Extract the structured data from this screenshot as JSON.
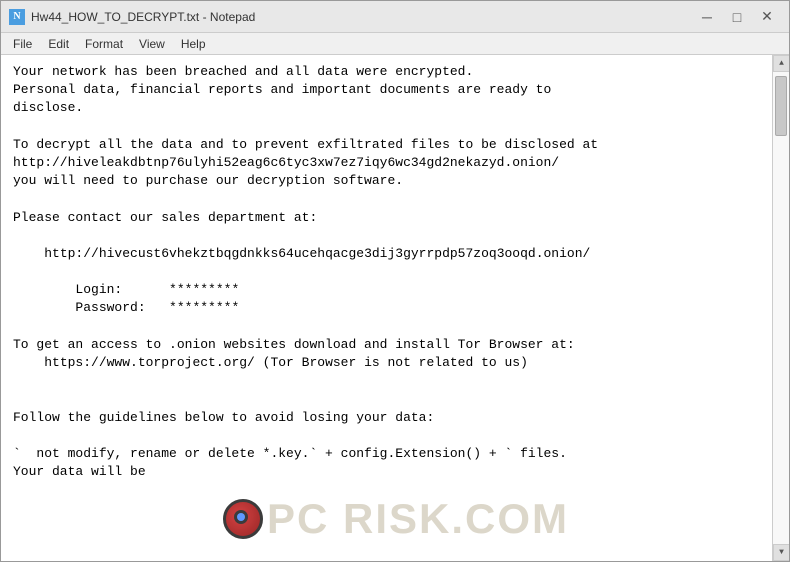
{
  "window": {
    "title": "Hw44_HOW_TO_DECRYPT.txt - Notepad",
    "icon_label": "N"
  },
  "title_buttons": {
    "minimize": "─",
    "maximize": "□",
    "close": "✕"
  },
  "menu": {
    "items": [
      "File",
      "Edit",
      "Format",
      "View",
      "Help"
    ]
  },
  "content": {
    "text": "Your network has been breached and all data were encrypted.\nPersonal data, financial reports and important documents are ready to\ndisclose.\n\nTo decrypt all the data and to prevent exfiltrated files to be disclosed at\nhttp://hiveleakdbtnp76ulyhi52eag6c6tyc3xw7ez7iqy6wc34gd2nekazyd.onion/\nyou will need to purchase our decryption software.\n\nPlease contact our sales department at:\n\n    http://hivecust6vhekztbqgdnkks64ucehqacge3dij3gyrrpdp57zoq3ooqd.onion/\n\n        Login:      *********\n        Password:   *********\n\nTo get an access to .onion websites download and install Tor Browser at:\n    https://www.torproject.org/ (Tor Browser is not related to us)\n\n\nFollow the guidelines below to avoid losing your data:\n\n`  not modify, rename or delete *.key.` + config.Extension() + ` files.\nYour data will be"
  },
  "watermark": {
    "text": "PC RISK.COM"
  }
}
